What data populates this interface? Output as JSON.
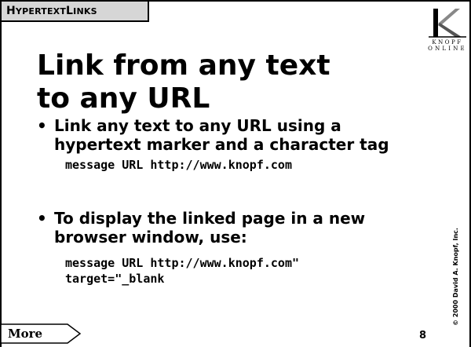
{
  "header": {
    "section_title_first": "H",
    "section_title_rest": "YPERTEXT ",
    "section_title_first2": "L",
    "section_title_rest2": "INKS"
  },
  "logo": {
    "line1": "KNOPF",
    "line2": "ONLINE",
    "icon": "knopf-k-logo-icon"
  },
  "title": {
    "line1": "Link from any text",
    "line2": "to any URL"
  },
  "bullets": [
    {
      "text_line1": "Link any text to any URL using a",
      "text_line2": "hypertext marker and a character tag"
    },
    {
      "text_line1": "To display the linked page in a new",
      "text_line2": "browser window, use:"
    }
  ],
  "bullet_glyph": "•",
  "code_lines": [
    "message URL http://www.knopf.com",
    "message URL http://www.knopf.com\"",
    "target=\"_blank"
  ],
  "footer": {
    "more_label": "More",
    "page_number": "8",
    "copyright": "© 2000 David A. Knopf, Inc."
  }
}
